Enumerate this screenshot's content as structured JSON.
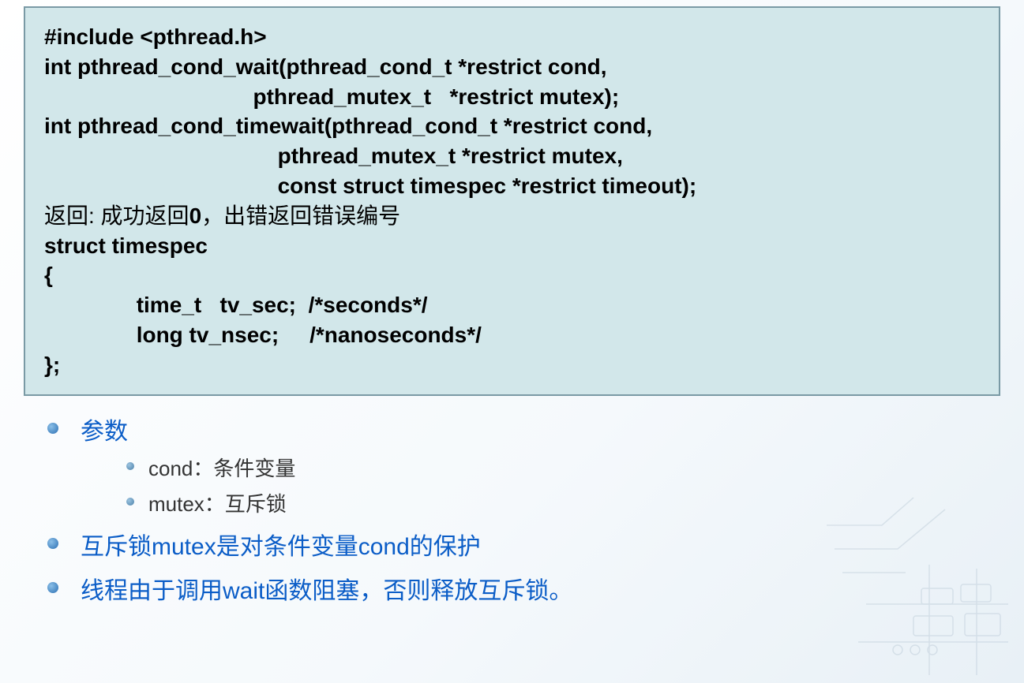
{
  "code": {
    "line1": "#include <pthread.h>",
    "line2": "int pthread_cond_wait(pthread_cond_t *restrict cond,",
    "line3_indent": "                                  pthread_mutex_t   *restrict mutex);",
    "line4": "int pthread_cond_timewait(pthread_cond_t  *restrict cond,",
    "line5_indent": "                                      pthread_mutex_t *restrict mutex,",
    "line6_indent": "                                      const struct timespec *restrict timeout);",
    "line7_prefix": "返回: 成功返回",
    "line7_zero": "0",
    "line7_suffix": "，出错返回错误编号",
    "line8": "struct timespec",
    "line9": "{",
    "line10": "               time_t   tv_sec;  /*seconds*/",
    "line11": "               long tv_nsec;     /*nanoseconds*/",
    "line12": "};"
  },
  "bullets": {
    "param_heading": "参数",
    "sub1": "cond：条件变量",
    "sub2": "mutex：互斥锁",
    "main2": "互斥锁mutex是对条件变量cond的保护",
    "main3": "线程由于调用wait函数阻塞，否则释放互斥锁。"
  }
}
